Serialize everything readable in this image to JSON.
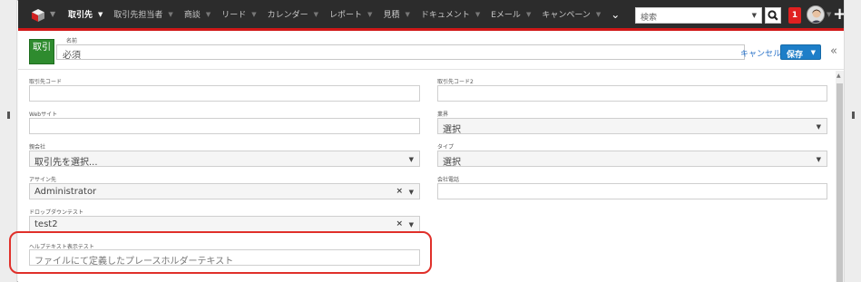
{
  "nav": {
    "items": [
      {
        "label": "取引先",
        "active": true
      },
      {
        "label": "取引先担当者",
        "active": false
      },
      {
        "label": "商談",
        "active": false
      },
      {
        "label": "リード",
        "active": false
      },
      {
        "label": "カレンダー",
        "active": false
      },
      {
        "label": "レポート",
        "active": false
      },
      {
        "label": "見積",
        "active": false
      },
      {
        "label": "ドキュメント",
        "active": false
      },
      {
        "label": "Eメール",
        "active": false
      },
      {
        "label": "キャンペーン",
        "active": false
      }
    ],
    "search_placeholder": "検索",
    "notification_count": "1"
  },
  "header": {
    "badge": "取引",
    "name_label": "名前",
    "name_placeholder": "必須",
    "cancel_label": "キャンセル",
    "save_label": "保存"
  },
  "form": {
    "left": [
      {
        "label": "取引先コード",
        "value": "",
        "type": "text"
      },
      {
        "label": "Webサイト",
        "value": "",
        "type": "text"
      },
      {
        "label": "親会社",
        "value": "取引先を選択...",
        "type": "select"
      },
      {
        "label": "アサイン先",
        "value": "Administrator",
        "type": "select-clear"
      },
      {
        "label": "ドロップダウンテスト",
        "value": "test2",
        "type": "select-clear"
      },
      {
        "label": "ヘルプテキスト表示テスト",
        "value": "ファイルにて定義したプレースホルダーテキスト",
        "type": "text-placeholder"
      }
    ],
    "right": [
      {
        "label": "取引先コード2",
        "value": "",
        "type": "text"
      },
      {
        "label": "業界",
        "value": "選択",
        "type": "select"
      },
      {
        "label": "タイプ",
        "value": "選択",
        "type": "select"
      },
      {
        "label": "会社電話",
        "value": "",
        "type": "text"
      }
    ]
  },
  "colors": {
    "nav_bg": "#2c2c2c",
    "nav_accent": "#d01818",
    "badge_green": "#2e8b2e",
    "save_blue": "#1d7ec8",
    "highlight_red": "#e0302a"
  }
}
